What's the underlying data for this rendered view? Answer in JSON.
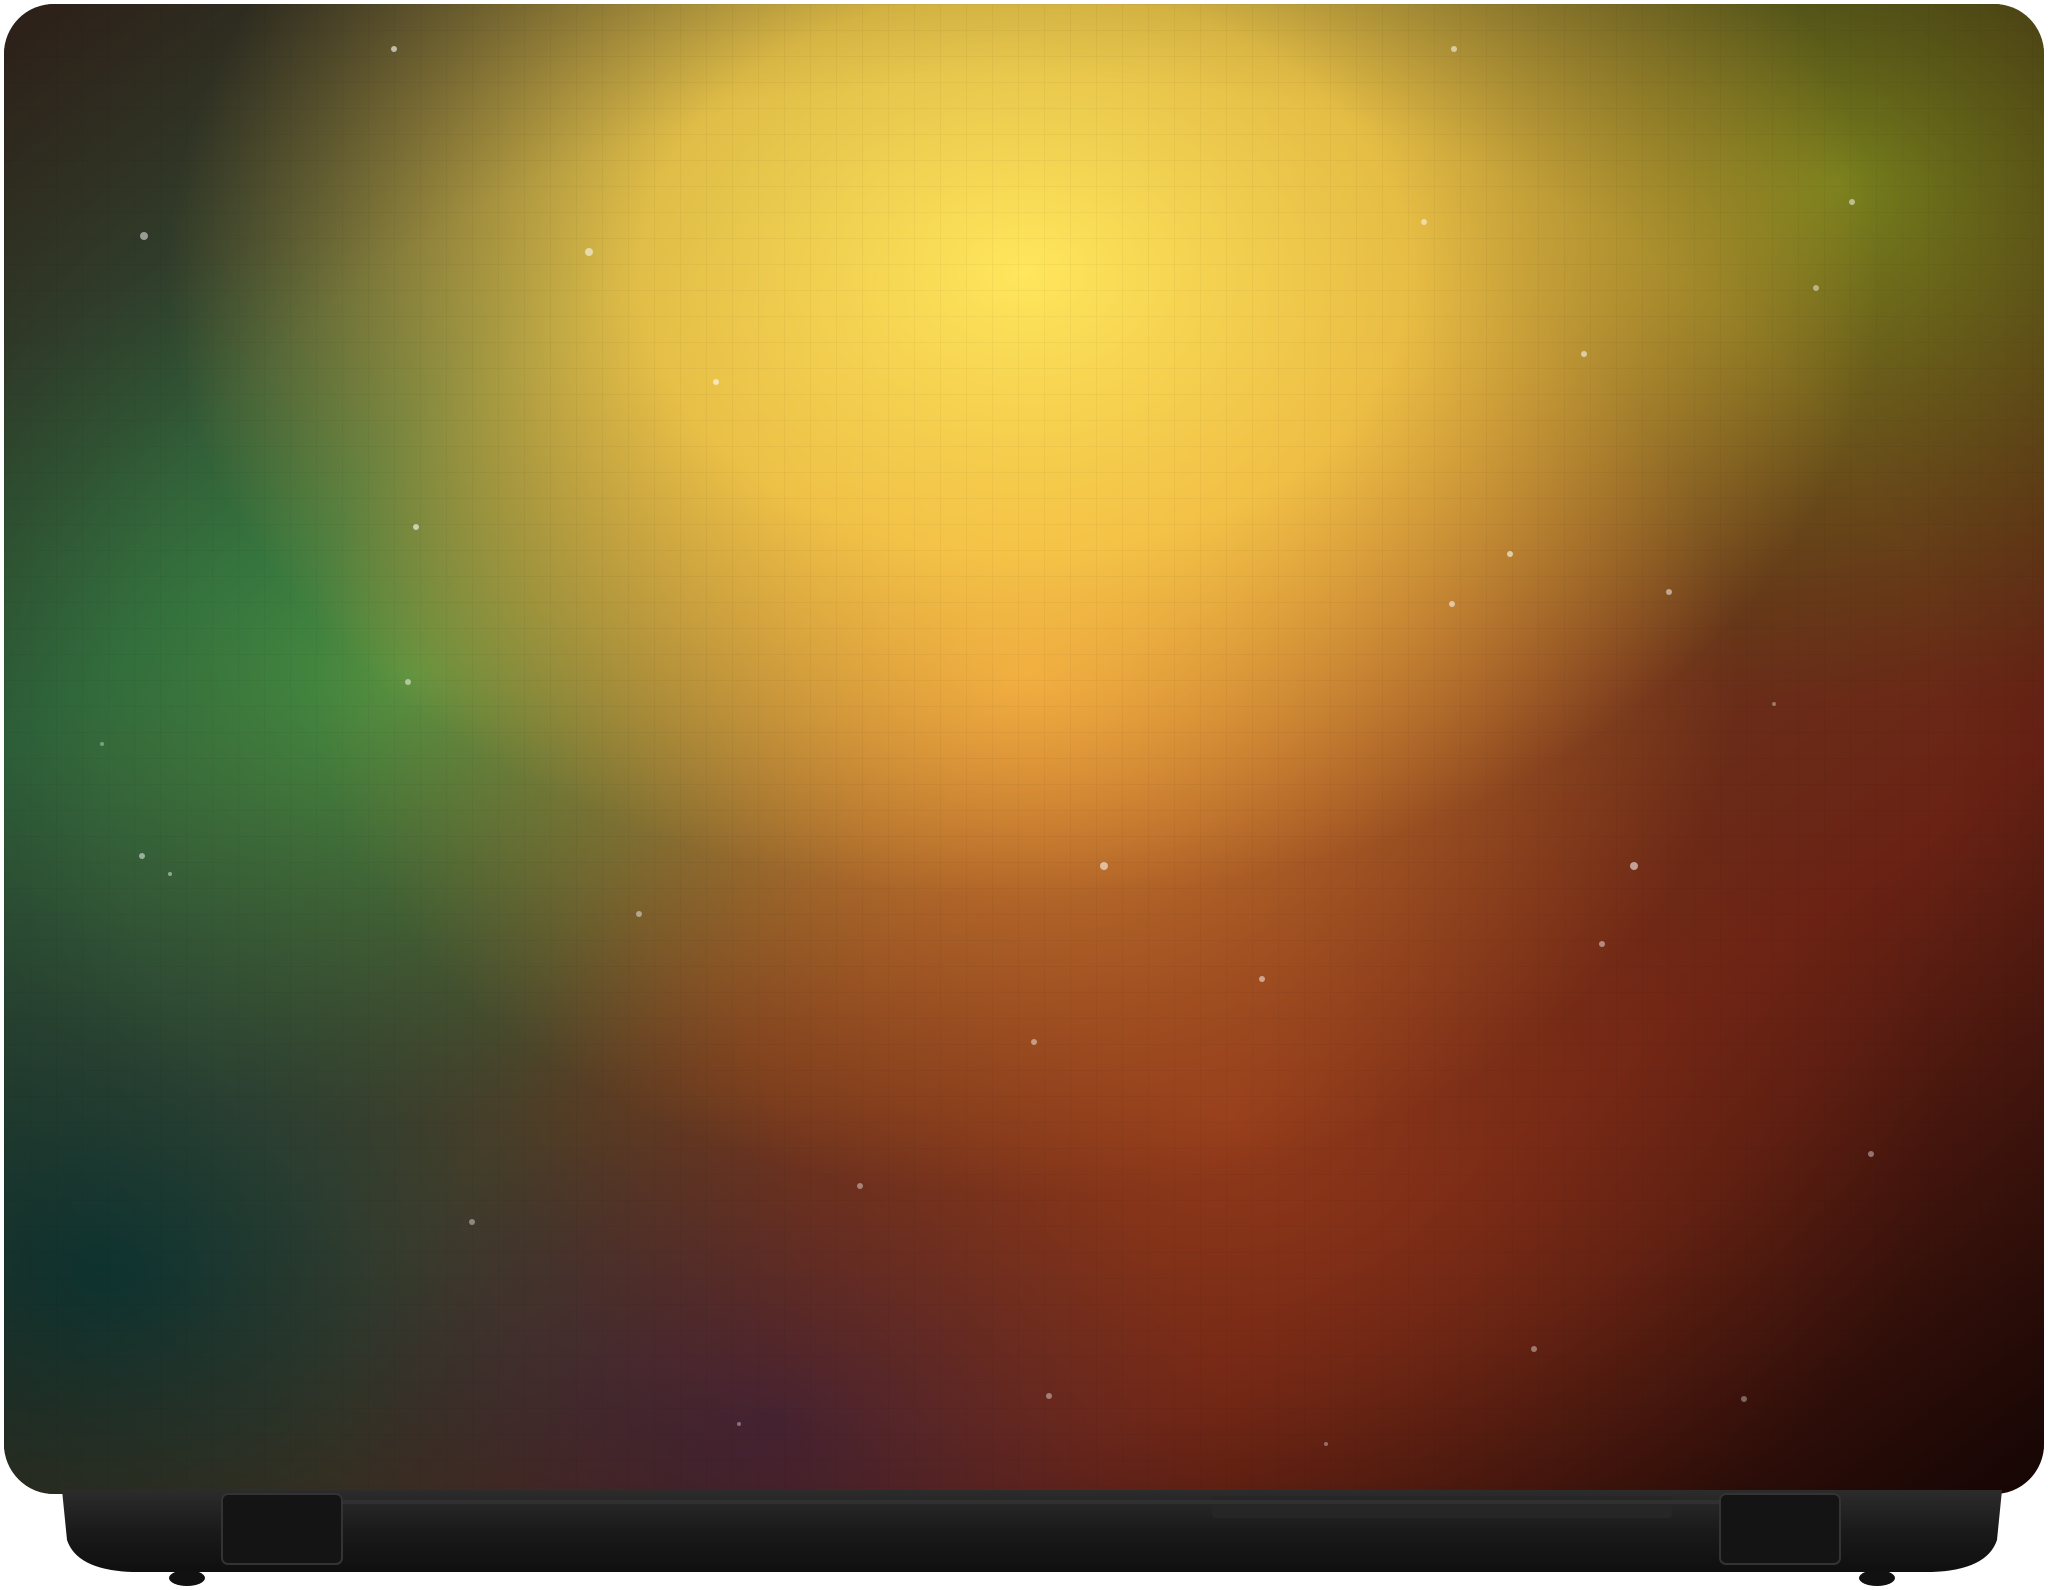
{
  "scene": {
    "subject": "laptop-with-skin",
    "skin": {
      "style": "gradient-glow",
      "colors": {
        "topLeft": "#3f2c22",
        "glowCenter": "#ffe25a",
        "glowOrange": "#f59a3a",
        "topRight": "#5f6a12",
        "midLeftGreen": "#3e8a3c",
        "bottomLeftTeal": "#0f3a36",
        "bottomCenterPurple": "#3a2236",
        "bottomRightRed": "#5a1a10",
        "bottomRightDark": "#2a0c08"
      },
      "pattern": "fine-grid",
      "particles": "bokeh-dots"
    },
    "base": {
      "color": "#1f1f1f",
      "highlight": "#3a3a3a"
    }
  }
}
